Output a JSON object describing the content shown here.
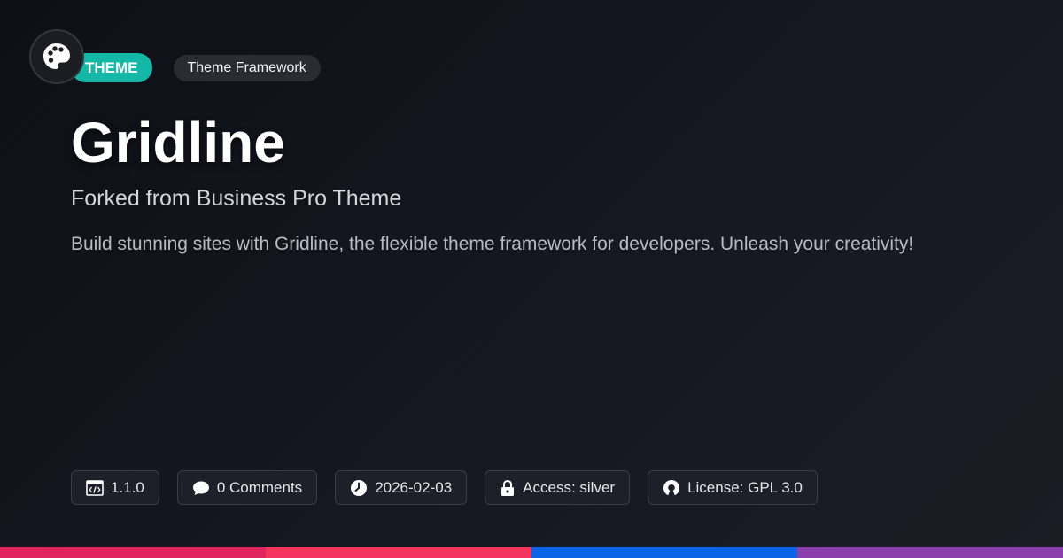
{
  "header": {
    "category_badge": "THEME",
    "type_badge": "Theme Framework"
  },
  "main": {
    "title": "Gridline",
    "subtitle": "Forked from Business Pro Theme",
    "description": "Build stunning sites with Gridline, the flexible theme framework for developers. Unleash your creativity!"
  },
  "meta": [
    {
      "icon": "code-window-icon",
      "label": "1.1.0"
    },
    {
      "icon": "comment-bubble-icon",
      "label": "0 Comments"
    },
    {
      "icon": "clock-icon",
      "label": "2026-02-03"
    },
    {
      "icon": "lock-icon",
      "label": "Access: silver"
    },
    {
      "icon": "open-source-icon",
      "label": "License: GPL 3.0"
    }
  ],
  "colors": {
    "accent": "#14b8a6",
    "stripe": [
      "#e0245e",
      "#f4365f",
      "#0b63e5",
      "#8a3fac"
    ]
  }
}
